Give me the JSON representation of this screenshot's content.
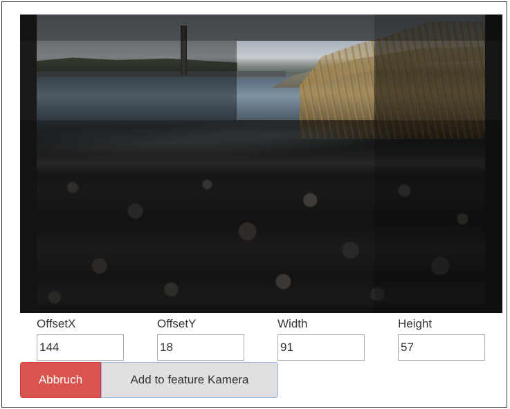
{
  "crop": {
    "image_description_icon": "crop-image-icon"
  },
  "fields": [
    {
      "label": "OffsetX",
      "value": "144"
    },
    {
      "label": "OffsetY",
      "value": "18"
    },
    {
      "label": "Width",
      "value": "91"
    },
    {
      "label": "Height",
      "value": "57"
    }
  ],
  "buttons": {
    "cancel_label": "Abbruch",
    "add_label": "Add to feature Kamera"
  },
  "colors": {
    "cancel_bg": "#d9534f",
    "add_bg": "#e0e0e0",
    "add_border_focus": "#8fb5e6"
  }
}
